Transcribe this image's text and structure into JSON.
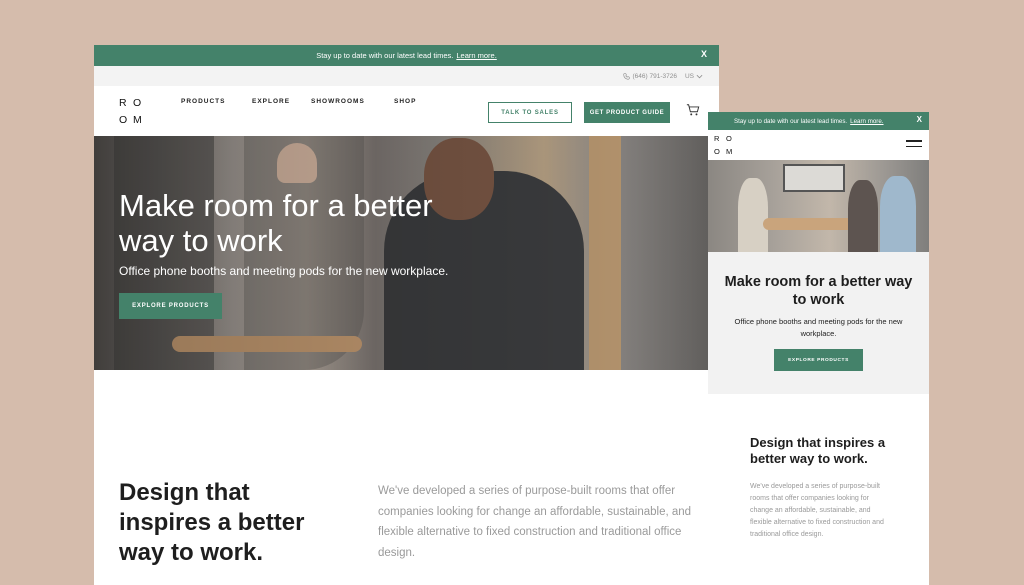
{
  "colors": {
    "accent": "#44826a",
    "background": "#d5bcac"
  },
  "desktop": {
    "banner": {
      "text": "Stay up to date with our latest lead times.",
      "link": "Learn more.",
      "close": "X"
    },
    "utility": {
      "phone_icon": "phone-icon",
      "phone": "(646) 791-3726",
      "region": "US",
      "region_icon": "chevron-down-icon"
    },
    "logo": {
      "letters": [
        "R",
        "O",
        "O",
        "M"
      ]
    },
    "nav": {
      "items": [
        "PRODUCTS",
        "EXPLORE",
        "SHOWROOMS",
        "SHOP"
      ]
    },
    "buttons": {
      "talk": "TALK TO SALES",
      "guide": "GET PRODUCT GUIDE"
    },
    "cart_icon": "cart-icon",
    "hero": {
      "title": "Make room for a better way to work",
      "subtitle": "Office phone booths and meeting pods for the new workplace.",
      "cta": "EXPLORE PRODUCTS"
    },
    "section": {
      "title": "Design that inspires a better way to work.",
      "body": "We've developed a series of purpose-built rooms that offer companies looking for change an affordable, sustainable, and flexible alternative to fixed construction and traditional office design."
    }
  },
  "mobile": {
    "banner": {
      "text": "Stay up to date with our latest lead times.",
      "link": "Learn more.",
      "close": "X"
    },
    "logo": {
      "letters": [
        "R",
        "O",
        "O",
        "M"
      ]
    },
    "menu_icon": "hamburger-menu-icon",
    "hero": {
      "title": "Make room for a better way to work",
      "subtitle": "Office phone booths and meeting pods for the new workplace.",
      "cta": "EXPLORE PRODUCTS"
    },
    "section": {
      "title": "Design that inspires a better way to work.",
      "body": "We've developed a series of purpose-built rooms that offer companies looking for change an affordable, sustainable, and flexible alternative to fixed construction and traditional office design."
    }
  }
}
